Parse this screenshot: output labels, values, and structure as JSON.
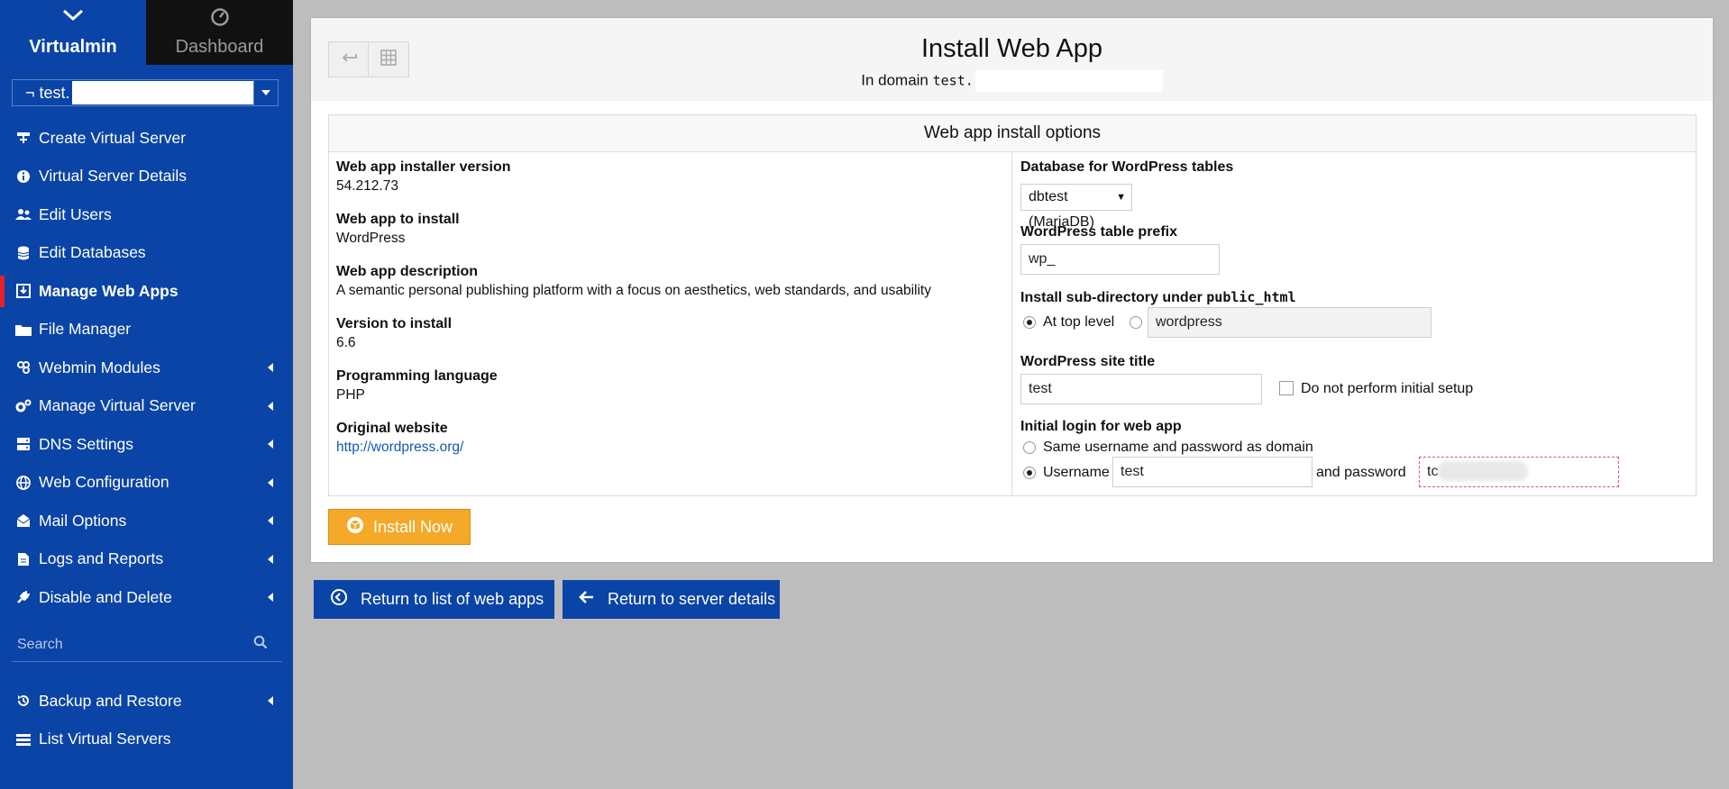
{
  "sidebar": {
    "tabs": [
      {
        "label": "Virtualmin",
        "icon": "virtualmin-logo-icon"
      },
      {
        "label": "Dashboard",
        "icon": "dashboard-gauge-icon"
      }
    ],
    "domain_select": {
      "value": "¬ test."
    },
    "menu": [
      {
        "label": "Create Virtual Server",
        "icon": "create-server-icon"
      },
      {
        "label": "Virtual Server Details",
        "icon": "info-icon"
      },
      {
        "label": "Edit Users",
        "icon": "users-icon"
      },
      {
        "label": "Edit Databases",
        "icon": "database-icon"
      },
      {
        "label": "Manage Web Apps",
        "icon": "web-apps-icon",
        "active": true
      },
      {
        "label": "File Manager",
        "icon": "folder-icon"
      },
      {
        "label": "Webmin Modules",
        "icon": "modules-icon",
        "submenu": true
      },
      {
        "label": "Manage Virtual Server",
        "icon": "cogs-icon",
        "submenu": true
      },
      {
        "label": "DNS Settings",
        "icon": "dns-icon",
        "submenu": true
      },
      {
        "label": "Web Configuration",
        "icon": "globe-icon",
        "submenu": true
      },
      {
        "label": "Mail Options",
        "icon": "mail-icon",
        "submenu": true
      },
      {
        "label": "Logs and Reports",
        "icon": "file-icon",
        "submenu": true
      },
      {
        "label": "Disable and Delete",
        "icon": "plug-icon",
        "submenu": true
      }
    ],
    "search": {
      "placeholder": "Search"
    },
    "menu2": [
      {
        "label": "Backup and Restore",
        "icon": "backup-icon",
        "submenu": true
      },
      {
        "label": "List Virtual Servers",
        "icon": "list-icon"
      }
    ]
  },
  "header": {
    "title": "Install Web App",
    "subtitle_prefix": "In domain",
    "subtitle_domain": "test."
  },
  "options": {
    "title": "Web app install options",
    "left": [
      {
        "label": "Web app installer version",
        "value": "54.212.73"
      },
      {
        "label": "Web app to install",
        "value": "WordPress"
      },
      {
        "label": "Web app description",
        "value": "A semantic personal publishing platform with a focus on aesthetics, web standards, and usability"
      },
      {
        "label": "Version to install",
        "value": "6.6"
      },
      {
        "label": "Programming language",
        "value": "PHP"
      },
      {
        "label": "Original website",
        "value": "http://wordpress.org/"
      }
    ],
    "right": {
      "db_label": "Database for WordPress tables",
      "db_value": "dbtest (MariaDB)",
      "prefix_label": "WordPress table prefix",
      "prefix_value": "wp_",
      "subdir_label": "Install sub-directory under",
      "subdir_code": "public_html",
      "subdir_top": "At top level",
      "subdir_value": "wordpress",
      "site_title_label": "WordPress site title",
      "site_title_value": "test",
      "no_setup_label": "Do not perform initial setup",
      "login_label": "Initial login for web app",
      "login_same": "Same username and password as domain",
      "login_username": "Username",
      "username_value": "test",
      "and_password": "and password",
      "password_value": "tc"
    }
  },
  "buttons": {
    "install": "Install Now",
    "return_list": "Return to list of web apps",
    "return_server": "Return to server details"
  },
  "colors": {
    "sidebar": "#0a44a6",
    "install": "#f4a929",
    "active_marker": "#e8202a"
  }
}
